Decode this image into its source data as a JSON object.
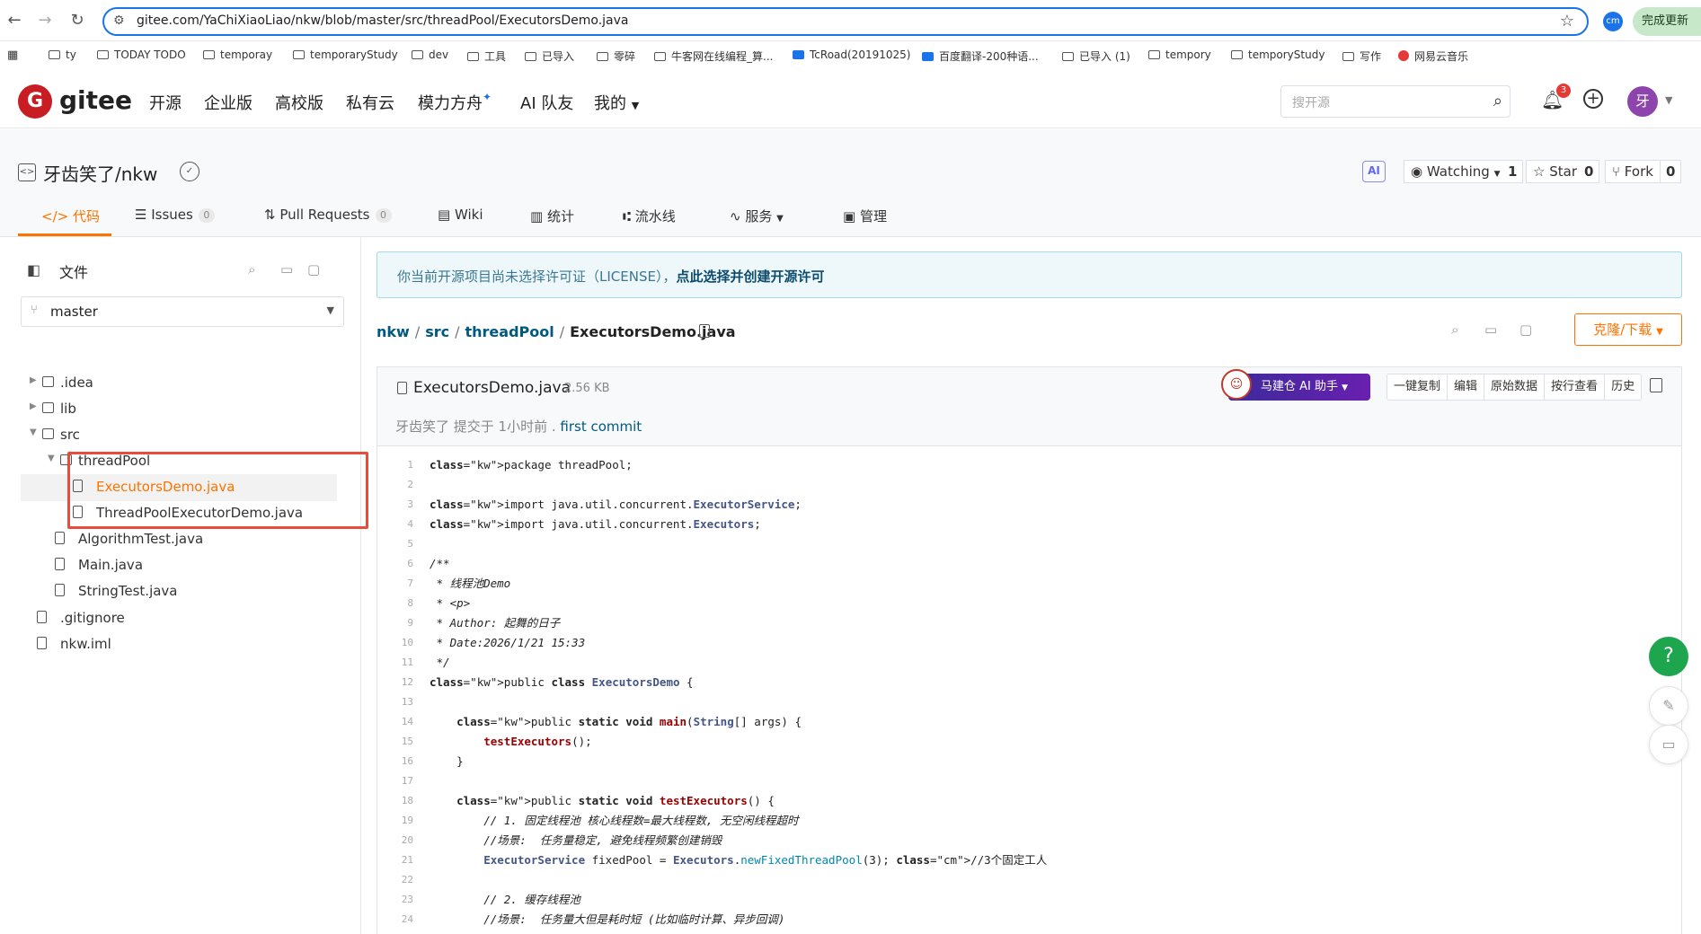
{
  "browser": {
    "url": "gitee.com/YaChiXiaoLiao/nkw/blob/master/src/threadPool/ExecutorsDemo.java",
    "profile": "cm",
    "update_label": "完成更新",
    "bookmarks": [
      "ty",
      "TODAY TODO",
      "temporay",
      "temporaryStudy",
      "dev",
      "工具",
      "已导入",
      "零碎",
      "牛客网在线编程_算...",
      "TcRoad(20191025)",
      "百度翻译-200种语...",
      "已导入 (1)",
      "tempory",
      "temporyStudy",
      "写作",
      "网易云音乐"
    ]
  },
  "header": {
    "logo": "gitee",
    "nav": [
      "开源",
      "企业版",
      "高校版",
      "私有云",
      "模力方舟",
      "AI 队友",
      "我的"
    ],
    "search_placeholder": "搜开源",
    "notification_count": "3",
    "avatar_initial": "牙"
  },
  "repo": {
    "title": "牙齿笑了/nkw",
    "ai_chip": "AI",
    "watching_label": "Watching",
    "watching_count": "1",
    "star_label": "Star",
    "star_count": "0",
    "fork_label": "Fork",
    "fork_count": "0",
    "tabs": [
      {
        "label": "代码"
      },
      {
        "label": "Issues",
        "count": "0"
      },
      {
        "label": "Pull Requests",
        "count": "0"
      },
      {
        "label": "Wiki"
      },
      {
        "label": "统计"
      },
      {
        "label": "流水线"
      },
      {
        "label": "服务"
      },
      {
        "label": "管理"
      }
    ]
  },
  "sidebar": {
    "title": "文件",
    "branch": "master",
    "tree": [
      {
        "label": ".idea",
        "type": "folder",
        "depth": 0,
        "expanded": false
      },
      {
        "label": "lib",
        "type": "folder",
        "depth": 0,
        "expanded": false
      },
      {
        "label": "src",
        "type": "folder",
        "depth": 0,
        "expanded": true
      },
      {
        "label": "threadPool",
        "type": "folder",
        "depth": 1,
        "expanded": true
      },
      {
        "label": "ExecutorsDemo.java",
        "type": "file",
        "depth": 2,
        "selected": true
      },
      {
        "label": "ThreadPoolExecutorDemo.java",
        "type": "file",
        "depth": 2
      },
      {
        "label": "AlgorithmTest.java",
        "type": "file",
        "depth": 1
      },
      {
        "label": "Main.java",
        "type": "file",
        "depth": 1
      },
      {
        "label": "StringTest.java",
        "type": "file",
        "depth": 1
      },
      {
        "label": ".gitignore",
        "type": "file",
        "depth": 0
      },
      {
        "label": "nkw.iml",
        "type": "file",
        "depth": 0
      }
    ]
  },
  "main": {
    "license_text": "你当前开源项目尚未选择许可证（LICENSE），",
    "license_link": "点此选择并创建开源许可",
    "breadcrumb": [
      "nkw",
      "src",
      "threadPool",
      "ExecutorsDemo.java"
    ],
    "clone_label": "克隆/下载",
    "file": {
      "name": "ExecutorsDemo.java",
      "size": "2.56 KB",
      "commit_text": "牙齿笑了 提交于 1小时前 .",
      "commit_link": "first commit",
      "ai_helper": "马建仓 AI 助手",
      "actions": [
        "一键复制",
        "编辑",
        "原始数据",
        "按行查看",
        "历史"
      ]
    },
    "code_lines": [
      "package threadPool;",
      "",
      "import java.util.concurrent.ExecutorService;",
      "import java.util.concurrent.Executors;",
      "",
      "/**",
      " * 线程池Demo",
      " * <p>",
      " * Author: 起舞的日子",
      " * Date:2026/1/21 15:33",
      " */",
      "public class ExecutorsDemo {",
      "",
      "    public static void main(String[] args) {",
      "        testExecutors();",
      "    }",
      "",
      "    public static void testExecutors() {",
      "        // 1. 固定线程池 核心线程数=最大线程数, 无空闲线程超时",
      "        //场景:  任务量稳定, 避免线程频繁创建销毁",
      "        ExecutorService fixedPool = Executors.newFixedThreadPool(3); //3个固定工人",
      "",
      "        // 2. 缓存线程池",
      "        //场景:  任务量大但是耗时短 (比如临时计算、异步回调)"
    ]
  },
  "floating": {
    "help": "?"
  }
}
